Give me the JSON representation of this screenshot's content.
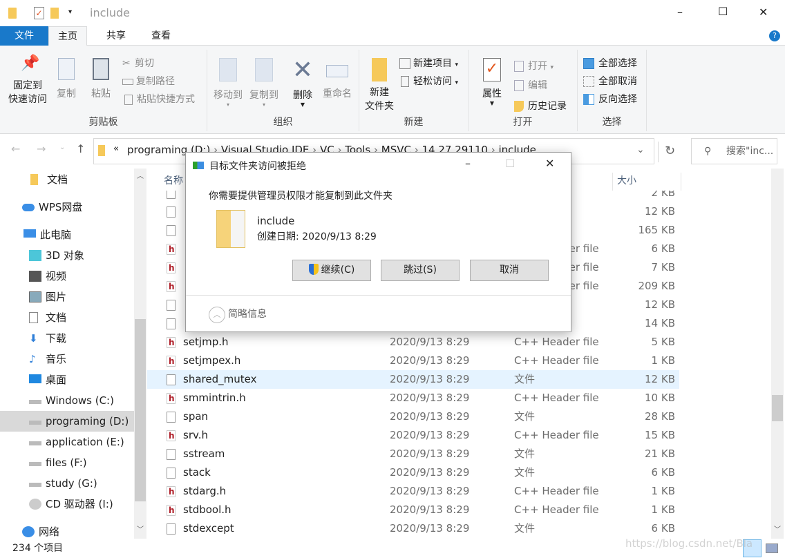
{
  "window": {
    "title": "include",
    "minimize": "–",
    "maximize": "☐",
    "close": "✕"
  },
  "tabs": [
    {
      "label": "文件"
    },
    {
      "label": "主页"
    },
    {
      "label": "共享"
    },
    {
      "label": "查看"
    }
  ],
  "ribbon": {
    "clipboard": {
      "label": "剪贴板",
      "pin": "固定到",
      "pin2": "快速访问",
      "copy": "复制",
      "paste": "粘贴",
      "cut": "剪切",
      "copy_path": "复制路径",
      "paste_shortcut": "粘贴快捷方式"
    },
    "organize": {
      "label": "组织",
      "move_to": "移动到",
      "copy_to": "复制到",
      "delete": "删除",
      "rename": "重命名"
    },
    "new": {
      "label": "新建",
      "new_folder": "新建",
      "new_folder2": "文件夹",
      "new_item": "新建项目",
      "easy_access": "轻松访问"
    },
    "open": {
      "label": "打开",
      "properties": "属性",
      "open": "打开",
      "edit": "编辑",
      "history": "历史记录"
    },
    "select": {
      "label": "选择",
      "select_all": "全部选择",
      "select_none": "全部取消",
      "invert": "反向选择"
    }
  },
  "address": {
    "path": [
      "programing (D:)",
      "Visual Studio IDE",
      "VC",
      "Tools",
      "MSVC",
      "14.27.29110",
      "include"
    ],
    "search_placeholder": "搜索\"inc..."
  },
  "nav": [
    {
      "label": "文档",
      "icon": "folder-icon"
    },
    {
      "label": "WPS网盘",
      "icon": "cloud-icon"
    },
    {
      "label": "此电脑",
      "icon": "computer-icon"
    },
    {
      "label": "3D 对象",
      "icon": "cube-icon"
    },
    {
      "label": "视频",
      "icon": "video-icon"
    },
    {
      "label": "图片",
      "icon": "picture-icon"
    },
    {
      "label": "文档",
      "icon": "document-icon"
    },
    {
      "label": "下载",
      "icon": "download-icon"
    },
    {
      "label": "音乐",
      "icon": "music-icon"
    },
    {
      "label": "桌面",
      "icon": "desktop-icon"
    },
    {
      "label": "Windows (C:)",
      "icon": "drive-icon"
    },
    {
      "label": "programing (D:)",
      "icon": "drive-icon",
      "selected": true
    },
    {
      "label": "application (E:)",
      "icon": "drive-icon"
    },
    {
      "label": "files (F:)",
      "icon": "drive-icon"
    },
    {
      "label": "study (G:)",
      "icon": "drive-icon"
    },
    {
      "label": "CD 驱动器 (I:)",
      "icon": "cd-icon"
    },
    {
      "label": "网络",
      "icon": "network-icon"
    }
  ],
  "list": {
    "headers": {
      "name": "名称",
      "size": "大小"
    },
    "rows": [
      {
        "name": "",
        "date": "",
        "type": "",
        "size": "2 KB",
        "h": false
      },
      {
        "name": "",
        "date": "",
        "type": "",
        "size": "12 KB",
        "h": false
      },
      {
        "name": "",
        "date": "",
        "type": "",
        "size": "165 KB",
        "h": false
      },
      {
        "name": "",
        "date": "",
        "type": "C++ Header file",
        "size": "6 KB",
        "h": true
      },
      {
        "name": "",
        "date": "",
        "type": "C++ Header file",
        "size": "7 KB",
        "h": true
      },
      {
        "name": "",
        "date": "",
        "type": "C++ Header file",
        "size": "209 KB",
        "h": true
      },
      {
        "name": "",
        "date": "",
        "type": "",
        "size": "12 KB",
        "h": false
      },
      {
        "name": "",
        "date": "",
        "type": "",
        "size": "14 KB",
        "h": false
      },
      {
        "name": "setjmp.h",
        "date": "2020/9/13 8:29",
        "type": "C++ Header file",
        "size": "5 KB",
        "h": true
      },
      {
        "name": "setjmpex.h",
        "date": "2020/9/13 8:29",
        "type": "C++ Header file",
        "size": "1 KB",
        "h": true
      },
      {
        "name": "shared_mutex",
        "date": "2020/9/13 8:29",
        "type": "文件",
        "size": "12 KB",
        "h": false,
        "hover": true
      },
      {
        "name": "smmintrin.h",
        "date": "2020/9/13 8:29",
        "type": "C++ Header file",
        "size": "10 KB",
        "h": true
      },
      {
        "name": "span",
        "date": "2020/9/13 8:29",
        "type": "文件",
        "size": "28 KB",
        "h": false
      },
      {
        "name": "srv.h",
        "date": "2020/9/13 8:29",
        "type": "C++ Header file",
        "size": "15 KB",
        "h": true
      },
      {
        "name": "sstream",
        "date": "2020/9/13 8:29",
        "type": "文件",
        "size": "21 KB",
        "h": false
      },
      {
        "name": "stack",
        "date": "2020/9/13 8:29",
        "type": "文件",
        "size": "6 KB",
        "h": false
      },
      {
        "name": "stdarg.h",
        "date": "2020/9/13 8:29",
        "type": "C++ Header file",
        "size": "1 KB",
        "h": true
      },
      {
        "name": "stdbool.h",
        "date": "2020/9/13 8:29",
        "type": "C++ Header file",
        "size": "1 KB",
        "h": true
      },
      {
        "name": "stdexcept",
        "date": "2020/9/13 8:29",
        "type": "文件",
        "size": "6 KB",
        "h": false
      }
    ]
  },
  "status": {
    "count": "234 个项目"
  },
  "dialog": {
    "title": "目标文件夹访问被拒绝",
    "message": "你需要提供管理员权限才能复制到此文件夹",
    "folder_name": "include",
    "created": "创建日期: 2020/9/13 8:29",
    "continue": "继续(C)",
    "skip": "跳过(S)",
    "cancel": "取消",
    "details": "简略信息"
  },
  "watermark": "https://blog.csdn.net/Bla",
  "colors": {
    "accent": "#1979ca",
    "hover": "#e5f3ff",
    "selected": "#d9d9d9"
  }
}
